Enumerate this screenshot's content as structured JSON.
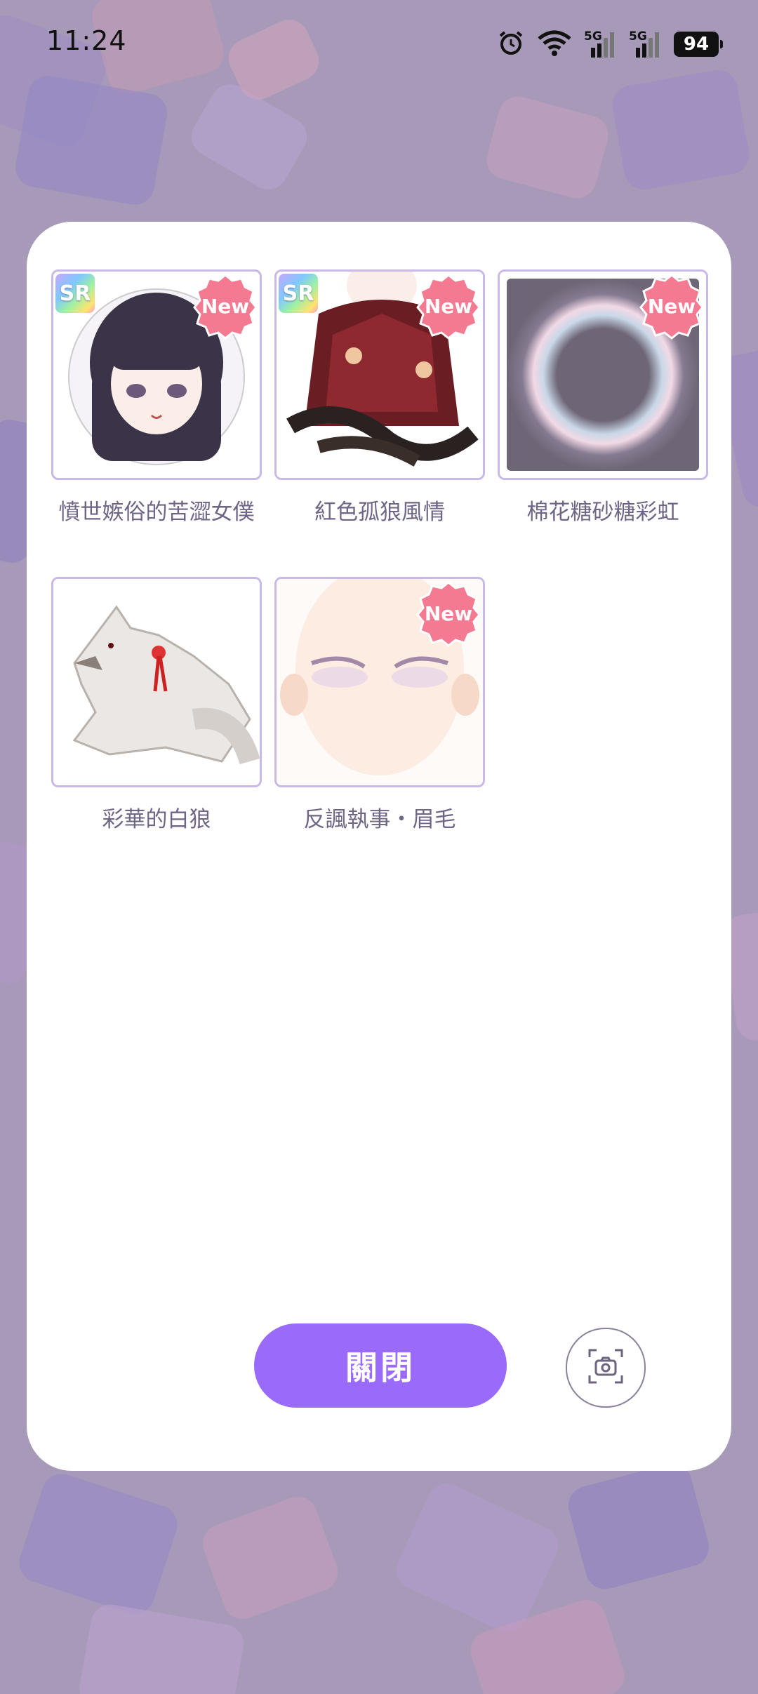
{
  "status_bar": {
    "time": "11:24",
    "signal_1": "5G",
    "signal_2": "5G",
    "battery": "94",
    "icons": [
      "alarm-icon",
      "wifi-icon",
      "signal-icon",
      "signal-icon",
      "battery-icon"
    ]
  },
  "items": [
    {
      "name": "憤世嫉俗的苦澀女僕",
      "sr": "SR",
      "new": "New"
    },
    {
      "name": "紅色孤狼風情",
      "sr": "SR",
      "new": "New"
    },
    {
      "name": "棉花糖砂糖彩虹",
      "new": "New"
    },
    {
      "name": "彩華的白狼"
    },
    {
      "name": "反諷執事・眉毛",
      "new": "New"
    }
  ],
  "actions": {
    "close_label": "關閉",
    "screenshot_icon": "camera-icon"
  },
  "colors": {
    "accent": "#9a6bfa",
    "thumb_border": "#c8b9e6",
    "caption": "#6f6585",
    "new_badge": "#f47a92"
  }
}
